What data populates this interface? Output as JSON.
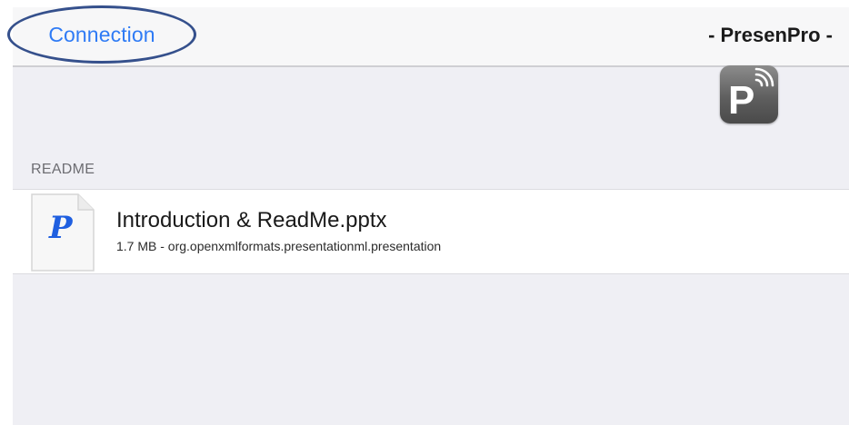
{
  "navbar": {
    "back_label": "Connection",
    "title": "- PresenPro -"
  },
  "logo": {
    "icon": "presenpro-logo-icon",
    "letter": "P"
  },
  "section": {
    "header": "README"
  },
  "files": [
    {
      "icon": "powerpoint-file-icon",
      "icon_letter": "P",
      "name": "Introduction & ReadMe.pptx",
      "size": "1.7 MB",
      "type": "org.openxmlformats.presentationml.presentation",
      "meta": "1.7 MB - org.openxmlformats.presentationml.presentation"
    }
  ],
  "colors": {
    "accent": "#2f7bf5",
    "highlight_ring": "#35508c",
    "background": "#efeff4",
    "file_icon_letter": "#1f5fe0"
  }
}
